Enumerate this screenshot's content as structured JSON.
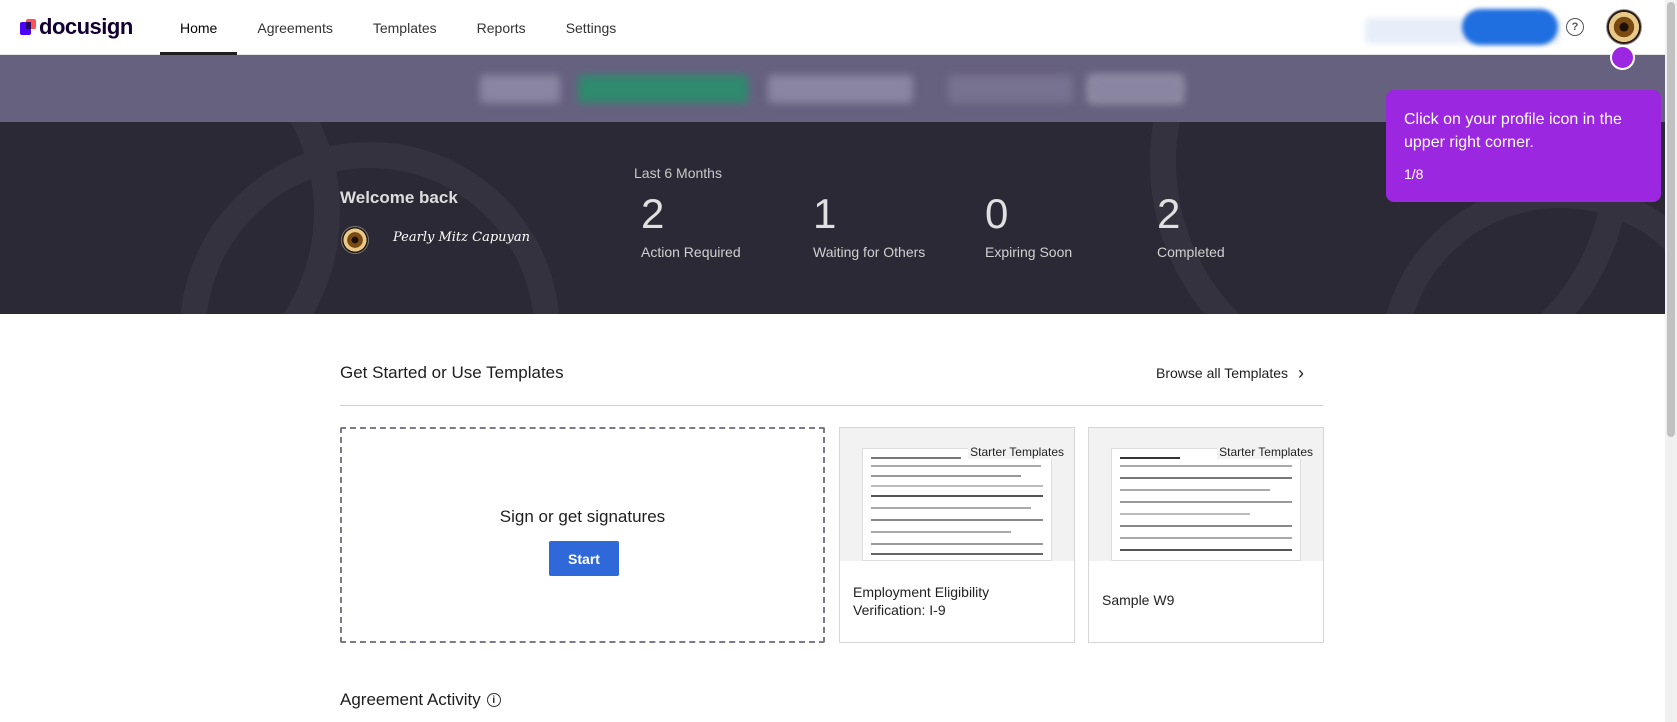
{
  "brand": {
    "name": "docusign"
  },
  "nav": {
    "items": [
      {
        "label": "Home",
        "active": true
      },
      {
        "label": "Agreements"
      },
      {
        "label": "Templates"
      },
      {
        "label": "Reports"
      },
      {
        "label": "Settings"
      }
    ],
    "help_icon": "help-circle-icon",
    "profile_icon": "avatar"
  },
  "dashboard": {
    "welcome": "Welcome back",
    "period": "Last 6 Months",
    "stats": [
      {
        "value": "2",
        "label": "Action Required"
      },
      {
        "value": "1",
        "label": "Waiting for Others"
      },
      {
        "value": "0",
        "label": "Expiring Soon"
      },
      {
        "value": "2",
        "label": "Completed"
      }
    ]
  },
  "tour": {
    "message": "Click on your profile icon in the upper right corner.",
    "step": "1/8",
    "color": "#9c27e0"
  },
  "templates_section": {
    "title": "Get Started or Use Templates",
    "browse_label": "Browse all Templates",
    "sign_title": "Sign or get signatures",
    "start_label": "Start",
    "cards": [
      {
        "badge": "Starter Templates",
        "name": "Employment Eligibility Verification: I-9"
      },
      {
        "badge": "Starter Templates",
        "name": "Sample W9"
      }
    ]
  },
  "activity": {
    "title": "Agreement Activity"
  },
  "colors": {
    "primary_button": "#2f68d8",
    "dashboard_bg": "#2c2936",
    "banner_bg": "#66617f"
  }
}
